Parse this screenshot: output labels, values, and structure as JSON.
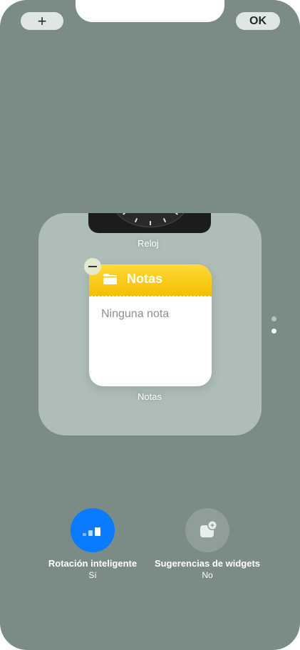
{
  "toolbar": {
    "add_label": "+",
    "done_label": "OK"
  },
  "stack": {
    "widgets": [
      {
        "name": "Reloj"
      },
      {
        "name": "Notas",
        "header": "Notas",
        "empty_text": "Ninguna nota"
      }
    ],
    "page_dots": 2,
    "active_page": 2
  },
  "options": {
    "smart_rotate": {
      "title": "Rotación inteligente",
      "value": "Sí",
      "icon": "smart-rotate-icon",
      "color": "#0a7aff"
    },
    "widget_suggestions": {
      "title": "Sugerencias de widgets",
      "value": "No",
      "icon": "widget-suggestion-icon",
      "color": "#8f9e99"
    }
  },
  "colors": {
    "background": "#7b8c87",
    "stack": "#aebdb8",
    "notes_yellow": "#f8cc1c"
  }
}
